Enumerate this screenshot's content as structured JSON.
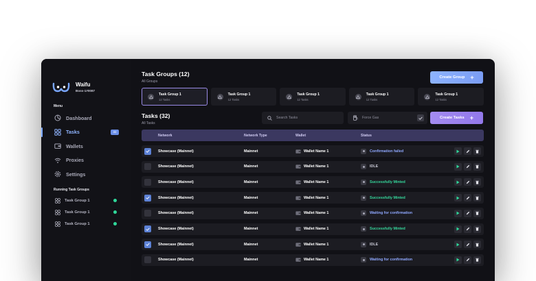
{
  "app": {
    "name": "Waifu",
    "user_id": "Boss-1#0087",
    "window_dots": [
      "#ff5f57",
      "#ffbd2e",
      "#28c840"
    ]
  },
  "sidebar": {
    "menu_title": "Menu",
    "items": [
      {
        "label": "Dashboard",
        "icon": "dashboard-icon"
      },
      {
        "label": "Tasks",
        "icon": "tasks-grid-icon",
        "badge": "32",
        "active": true
      },
      {
        "label": "Wallets",
        "icon": "wallet-icon"
      },
      {
        "label": "Proxies",
        "icon": "wifi-icon"
      },
      {
        "label": "Settings",
        "icon": "gear-icon"
      }
    ],
    "running_title": "Running Task Groups",
    "running": [
      {
        "label": "Task Group 1",
        "status_color": "#2fd89a"
      },
      {
        "label": "Task Group 1",
        "status_color": "#2fd89a"
      },
      {
        "label": "Task Group 1",
        "status_color": "#2fd89a"
      }
    ]
  },
  "task_groups": {
    "title": "Task Groups (12)",
    "subtitle": "All Groups",
    "create_label": "Create Group",
    "cards": [
      {
        "name": "Task Group 1",
        "count": "12 Tasks",
        "selected": true
      },
      {
        "name": "Task Group 1",
        "count": "12 Tasks"
      },
      {
        "name": "Task Group 1",
        "count": "12 Tasks"
      },
      {
        "name": "Task Group 1",
        "count": "12 Tasks"
      },
      {
        "name": "Task Group 1",
        "count": "12 Tasks"
      }
    ]
  },
  "tasks": {
    "title": "Tasks (32)",
    "subtitle": "All Tasks",
    "search_placeholder": "Search Tasks",
    "gas_label": "Force Gas",
    "create_label": "Create Tasks",
    "columns": [
      "Network",
      "Network Type",
      "Wallet",
      "Status"
    ],
    "rows": [
      {
        "checked": true,
        "network": "Showcase (Mainnet)",
        "type": "Mainnet",
        "wallet": "Wallet Name 1",
        "status": "Confirmation failed",
        "status_color": "#8fa8ff"
      },
      {
        "checked": false,
        "network": "Showcase (Mainnet)",
        "type": "Mainnet",
        "wallet": "Wallet Name 1",
        "status": "IDLE",
        "status_color": "#c8c8d4"
      },
      {
        "checked": false,
        "network": "Showcase (Mainnet)",
        "type": "Mainnet",
        "wallet": "Wallet Name 1",
        "status": "Successfully Minted",
        "status_color": "#35d89c"
      },
      {
        "checked": true,
        "network": "Showcase (Mainnet)",
        "type": "Mainnet",
        "wallet": "Wallet Name 1",
        "status": "Successfully Minted",
        "status_color": "#35d89c"
      },
      {
        "checked": false,
        "network": "Showcase (Mainnet)",
        "type": "Mainnet",
        "wallet": "Wallet Name 1",
        "status": "Waiting for confirmation",
        "status_color": "#8fa8ff"
      },
      {
        "checked": true,
        "network": "Showcase (Mainnet)",
        "type": "Mainnet",
        "wallet": "Wallet Name 1",
        "status": "Successfully Minted",
        "status_color": "#35d89c"
      },
      {
        "checked": true,
        "network": "Showcase (Mainnet)",
        "type": "Mainnet",
        "wallet": "Wallet Name 1",
        "status": "IDLE",
        "status_color": "#c8c8d4"
      },
      {
        "checked": false,
        "network": "Showcase (Mainnet)",
        "type": "Mainnet",
        "wallet": "Wallet Name 1",
        "status": "Waiting for confirmation",
        "status_color": "#8fa8ff"
      }
    ],
    "action_icons": [
      "play-icon",
      "edit-icon",
      "delete-icon"
    ],
    "play_color": "#2fd89a"
  }
}
